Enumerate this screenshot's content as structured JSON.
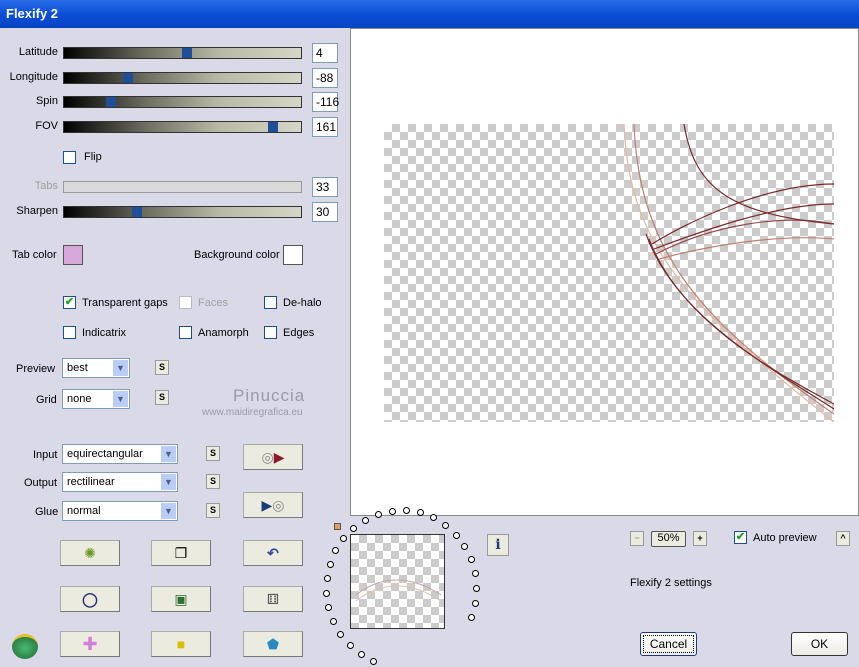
{
  "window": {
    "title": "Flexify 2"
  },
  "sliders": [
    {
      "label": "Latitude",
      "value": "4",
      "position": 0.52,
      "enabled": true
    },
    {
      "label": "Longitude",
      "value": "-88",
      "position": 0.27,
      "enabled": true
    },
    {
      "label": "Spin",
      "value": "-116",
      "position": 0.2,
      "enabled": true
    },
    {
      "label": "FOV",
      "value": "161",
      "position": 0.88,
      "enabled": true
    },
    {
      "label": "Tabs",
      "value": "33",
      "position": null,
      "enabled": false
    },
    {
      "label": "Sharpen",
      "value": "30",
      "position": 0.31,
      "enabled": true
    }
  ],
  "flip": {
    "label": "Flip",
    "checked": false
  },
  "colors": {
    "tab_label": "Tab color",
    "tab_value": "#d8a8dc",
    "bg_label": "Background color",
    "bg_value": "#ffffff"
  },
  "options": {
    "transparent_gaps": "Transparent gaps",
    "faces": "Faces",
    "de_halo": "De-halo",
    "indicatrix": "Indicatrix",
    "anamorph": "Anamorph",
    "edges": "Edges"
  },
  "preview": {
    "label": "Preview",
    "value": "best"
  },
  "grid": {
    "label": "Grid",
    "value": "none"
  },
  "s_label": "S",
  "watermark": {
    "name": "Pinuccia",
    "url": "www.maidiregrafica.eu"
  },
  "projection": {
    "input_label": "Input",
    "input_value": "equirectangular",
    "output_label": "Output",
    "output_value": "rectilinear",
    "glue_label": "Glue",
    "glue_value": "normal"
  },
  "zoom": {
    "minus": "−",
    "value": "50%",
    "plus": "+"
  },
  "auto_preview": {
    "label": "Auto preview",
    "checked": true
  },
  "collapse_label": "^",
  "info_label": "i",
  "settings_name": "Flexify 2 settings",
  "buttons": {
    "cancel": "Cancel",
    "ok": "OK"
  }
}
